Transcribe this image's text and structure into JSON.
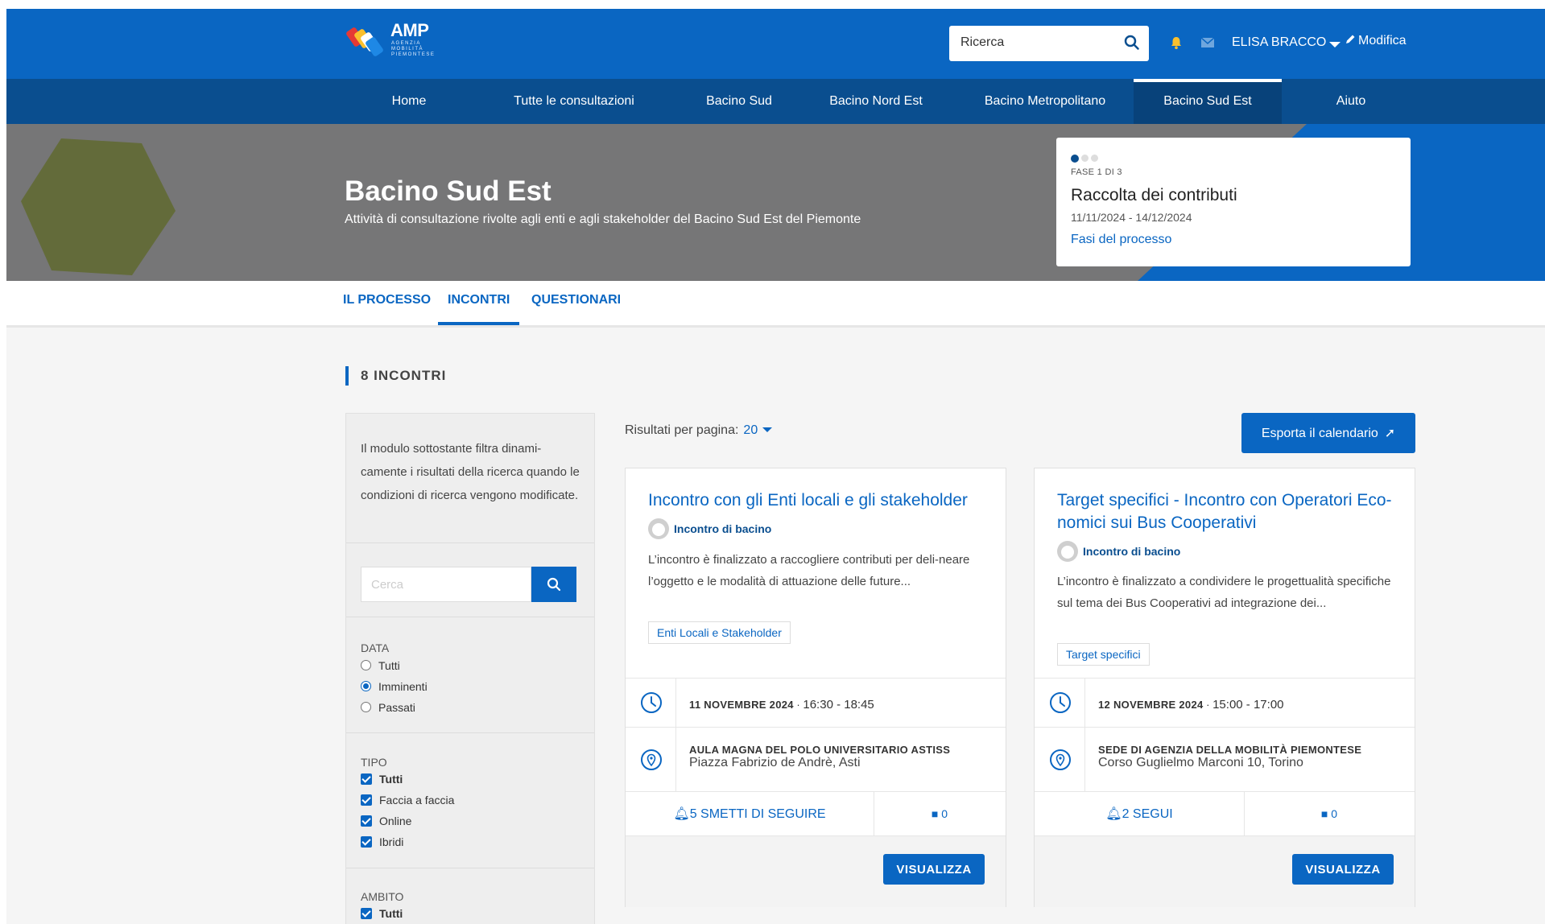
{
  "header": {
    "logo_text": "AMP",
    "logo_sub": "AGENZIA MOBILITÀ PIEMONTESE",
    "search_placeholder": "Ricerca",
    "user_name": "ELISA BRACCO",
    "edit_label": "Modifica"
  },
  "nav": {
    "items": [
      {
        "label": "Home"
      },
      {
        "label": "Tutte le consultazioni"
      },
      {
        "label": "Bacino Sud"
      },
      {
        "label": "Bacino Nord Est"
      },
      {
        "label": "Bacino Metropolitano"
      },
      {
        "label": "Bacino Sud Est",
        "active": true
      },
      {
        "label": "Aiuto"
      }
    ]
  },
  "hero": {
    "title": "Bacino Sud Est",
    "subtitle": "Attività di consultazione rivolte agli enti e agli stakeholder del Bacino Sud Est del Piemonte",
    "phase": {
      "step": "FASE 1 DI 3",
      "title": "Raccolta dei contributi",
      "dates": "11/11/2024 - 14/12/2024",
      "link": "Fasi del processo"
    }
  },
  "tabs": [
    {
      "label": "IL PROCESSO"
    },
    {
      "label": "INCONTRI",
      "active": true
    },
    {
      "label": "QUESTIONARI"
    }
  ],
  "section_title": "8 INCONTRI",
  "filters": {
    "intro": "Il modulo sottostante filtra dinami-camente i risultati della ricerca quando le condizioni di ricerca vengono modificate.",
    "search_placeholder": "Cerca",
    "data": {
      "title": "DATA",
      "options": [
        "Tutti",
        "Imminenti",
        "Passati"
      ],
      "selected": "Imminenti"
    },
    "tipo": {
      "title": "TIPO",
      "options": [
        "Tutti",
        "Faccia a faccia",
        "Online",
        "Ibridi"
      ]
    },
    "ambito": {
      "title": "AMBITO",
      "options": [
        "Tutti"
      ]
    }
  },
  "results": {
    "per_page_label": "Risultati per pagina:",
    "per_page_value": "20",
    "export_label": "Esporta il calendario",
    "view_label": "VISUALIZZA",
    "cards": [
      {
        "title": "Incontro con gli Enti locali e gli stakeholder",
        "author": "Incontro di bacino",
        "description": "L’incontro è finalizzato a raccogliere contributi per deli-neare l’oggetto e le modalità di attuazione delle future...",
        "tag": "Enti Locali e Stakeholder",
        "date": "11 NOVEMBRE 2024",
        "time": "16:30 - 18:45",
        "venue": "AULA MAGNA DEL POLO UNIVERSITARIO ASTISS",
        "address": "Piazza Fabrizio de Andrè, Asti",
        "follow": "5 SMETTI DI SEGUIRE",
        "comments": "0"
      },
      {
        "title": "Target specifici - Incontro con Operatori Eco-nomici sui Bus Cooperativi",
        "author": "Incontro di bacino",
        "description": "L’incontro è finalizzato a condividere le progettualità specifiche sul tema dei Bus Cooperativi ad integrazione dei...",
        "tag": "Target specifici",
        "date": "12 NOVEMBRE 2024",
        "time": "15:00 - 17:00",
        "venue": "SEDE DI AGENZIA DELLA MOBILITÀ PIEMONTESE",
        "address": "Corso Guglielmo Marconi 10, Torino",
        "follow": "2 SEGUI",
        "comments": "0"
      }
    ]
  },
  "colors": {
    "primary": "#0a66c2",
    "nav": "#0a4e8f",
    "hero_grey": "#767677",
    "hexagon": "#636b3a"
  }
}
